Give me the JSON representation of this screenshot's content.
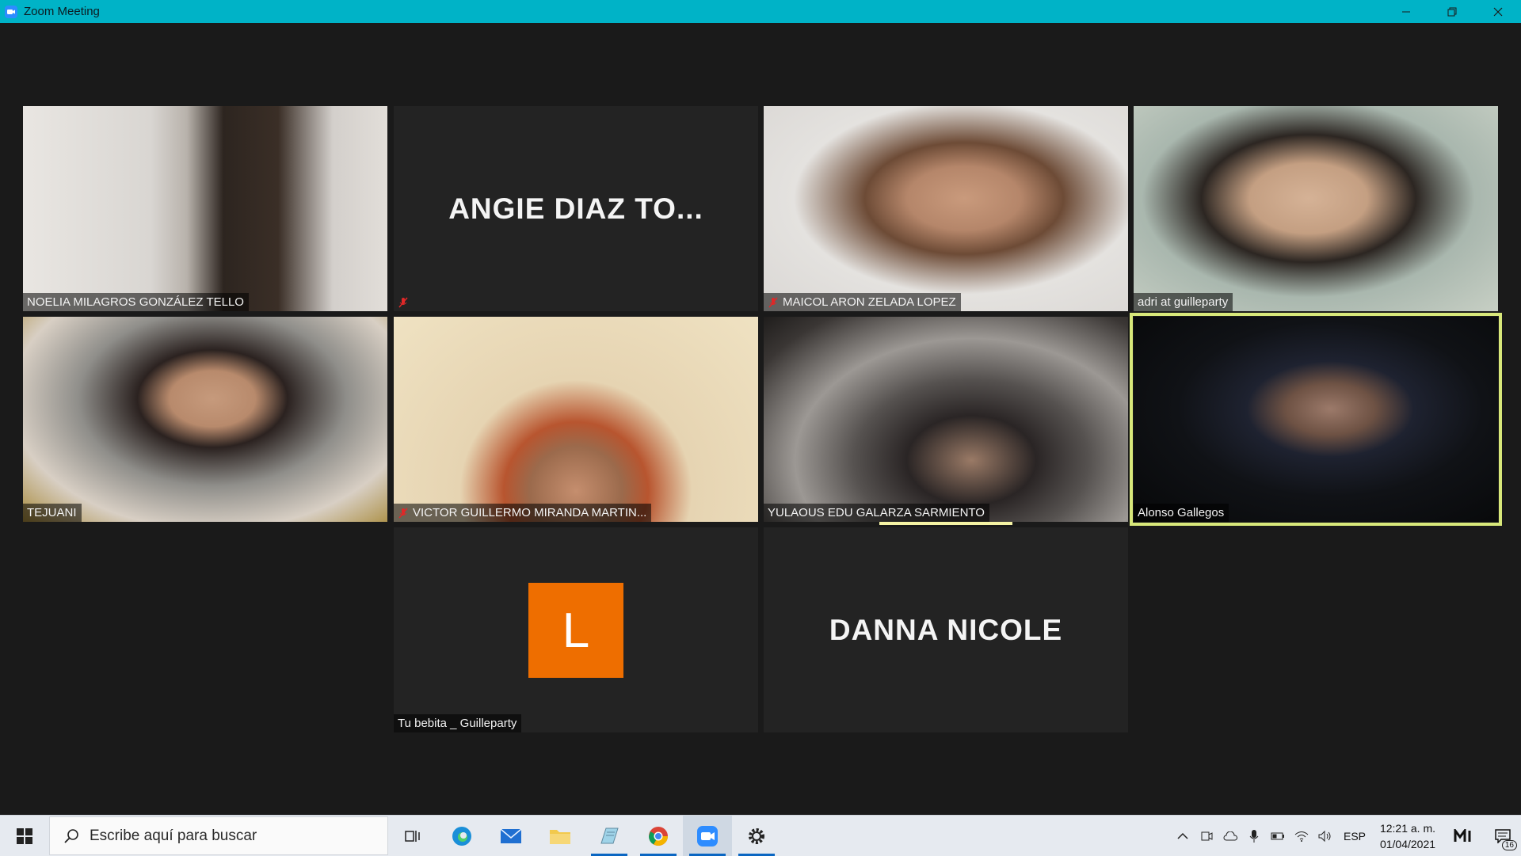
{
  "window": {
    "title": "Zoom Meeting"
  },
  "participants": [
    {
      "name": "NOELIA MILAGROS GONZÁLEZ TELLO",
      "muted": false
    },
    {
      "name": "",
      "display_name": "ANGIE DIAZ TO...",
      "muted": true
    },
    {
      "name": "MAICOL ARON ZELADA LOPEZ",
      "muted": true
    },
    {
      "name": "adri at guilleparty",
      "muted": false
    },
    {
      "name": "TEJUANI",
      "muted": false
    },
    {
      "name": "VICTOR GUILLERMO MIRANDA MARTIN...",
      "muted": true
    },
    {
      "name": "YULAOUS EDU GALARZA SARMIENTO",
      "muted": false
    },
    {
      "name": "Alonso Gallegos",
      "muted": false,
      "active_speaker": true
    },
    {
      "name": "Tu bebita _ Guilleparty",
      "avatar_letter": "L",
      "avatar_color": "#ee6e00"
    },
    {
      "name": "",
      "display_name": "DANNA NICOLE"
    }
  ],
  "taskbar": {
    "search_placeholder": "Escribe aquí para buscar",
    "language": "ESP",
    "time": "12:21 a. m.",
    "date": "01/04/2021",
    "notification_count": "16"
  },
  "colors": {
    "titlebar": "#00b3c7",
    "active_speaker_border": "#d8e87a",
    "tile_bg": "#232323"
  }
}
